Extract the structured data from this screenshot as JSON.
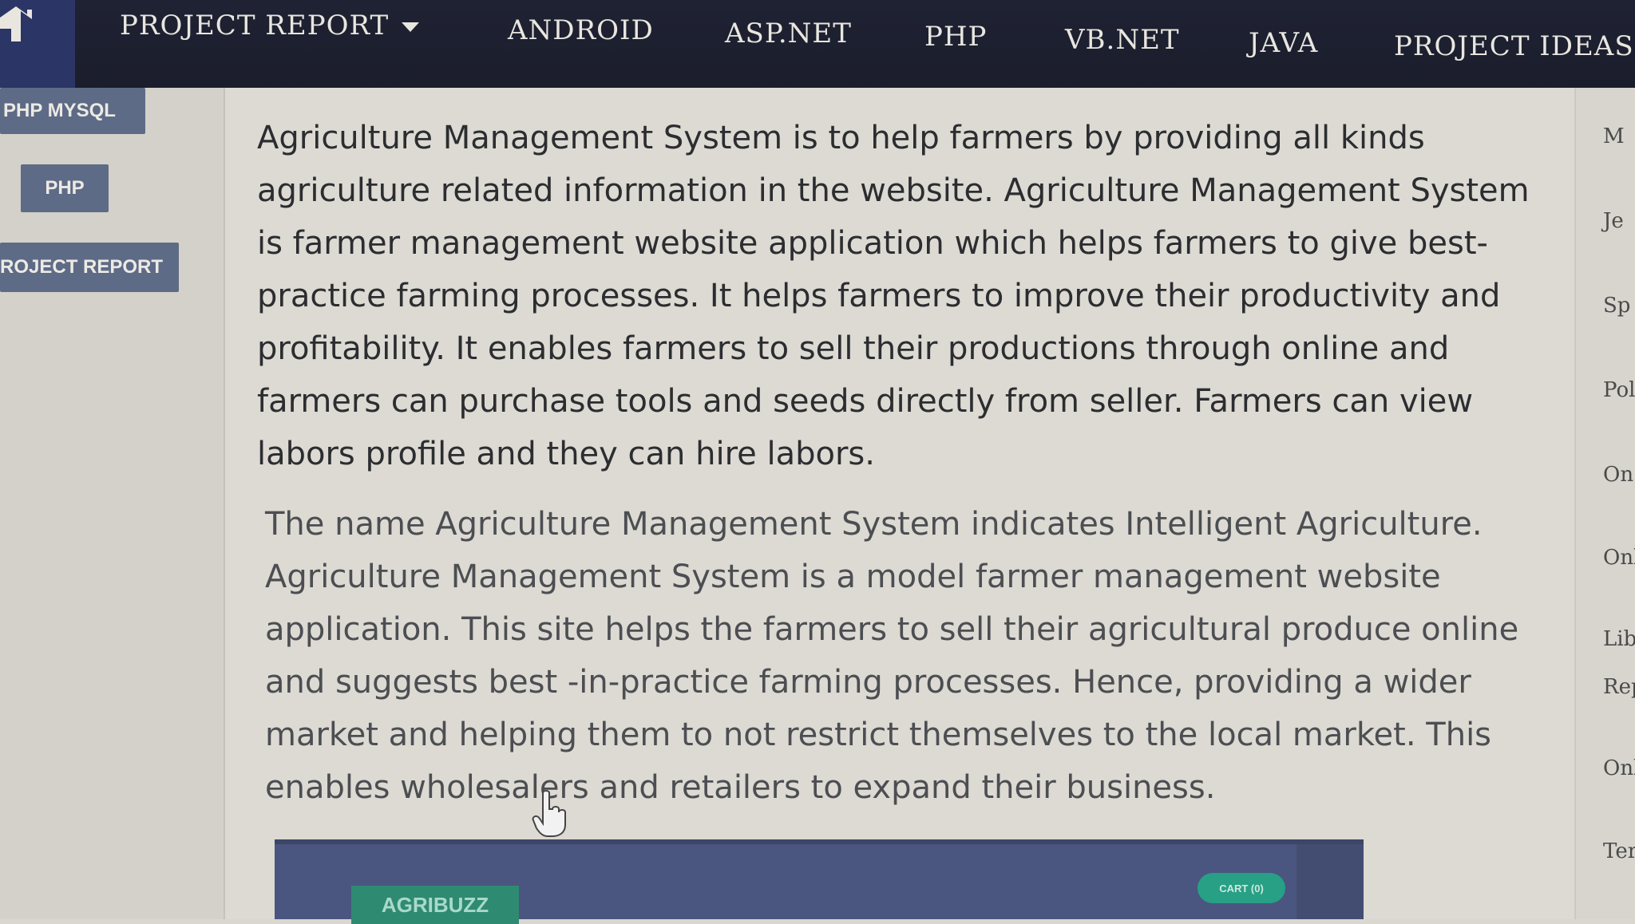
{
  "topnav": {
    "items": [
      {
        "label": "PROJECT REPORT",
        "has_dropdown": true
      },
      {
        "label": "ANDROID"
      },
      {
        "label": "ASP.NET"
      },
      {
        "label": "PHP"
      },
      {
        "label": "VB.NET"
      },
      {
        "label": "JAVA"
      },
      {
        "label": "PROJECT IDEAS"
      }
    ],
    "home_icon": "home-icon"
  },
  "sidebar": {
    "buttons": [
      {
        "label": "PHP MYSQL"
      },
      {
        "label": "PHP"
      },
      {
        "label": "ROJECT REPORT"
      }
    ]
  },
  "article": {
    "paragraph1": "Agriculture Management System is to help farmers by providing all kinds agriculture related information in the website. Agriculture Management System is farmer management website application which helps farmers to give best-practice farming processes. It helps farmers to improve their productivity and profitability. It enables farmers to sell their productions through online and farmers can purchase tools and seeds directly from seller. Farmers can view labors profile and they can hire labors.",
    "paragraph2": "The name Agriculture Management System indicates Intelligent Agriculture. Agriculture Management System is a model farmer management website application. This site helps the farmers to sell their agricultural produce online and suggests best -in-practice farming processes. Hence, providing a wider market and helping them to not restrict themselves to the local market. This enables wholesalers and retailers to expand their business."
  },
  "right_column": {
    "items": [
      "M",
      "Je",
      "Sp",
      "Pol",
      "On",
      "Onl",
      "Lib",
      "Rep",
      "Onl",
      "Ter"
    ]
  },
  "preview": {
    "brand": "AGRIBUZZ",
    "cart_label": "CART (0)"
  },
  "colors": {
    "nav_bg": "#1f2233",
    "home_tile": "#2b3566",
    "sidebar_button": "#5e6b86",
    "preview_bg": "#4a5680",
    "preview_accent": "#2f8a72"
  }
}
